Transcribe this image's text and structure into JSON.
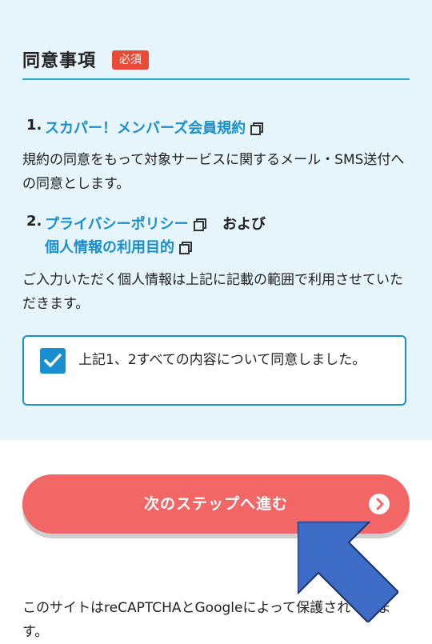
{
  "consent": {
    "title": "同意事項",
    "required_badge": "必須",
    "items": [
      {
        "num": "1.",
        "link": "スカパー！メンバーズ会員規約"
      },
      {
        "num": "2.",
        "link": "プライバシーポリシー",
        "conjunction": "および",
        "link2": "個人情報の利用目的"
      }
    ],
    "desc1": "規約の同意をもって対象サービスに関するメール・SMS送付への同意とします。",
    "desc2": "ご入力いただく個人情報は上記に記載の範囲で利用させていただきます。",
    "agree_label": "上記1、2すべての内容について同意しました。",
    "agree_checked": true
  },
  "next_button": {
    "label": "次のステップへ進む",
    "icon": "chevron-right-circle-icon"
  },
  "recaptcha_note": "このサイトはreCAPTCHAとGoogleによって保護されています。",
  "colors": {
    "panel_bg": "#e6f4fb",
    "accent": "#1a8fd0",
    "badge": "#e84b35",
    "button": "#f26766",
    "arrow": "#3d6cc6"
  }
}
